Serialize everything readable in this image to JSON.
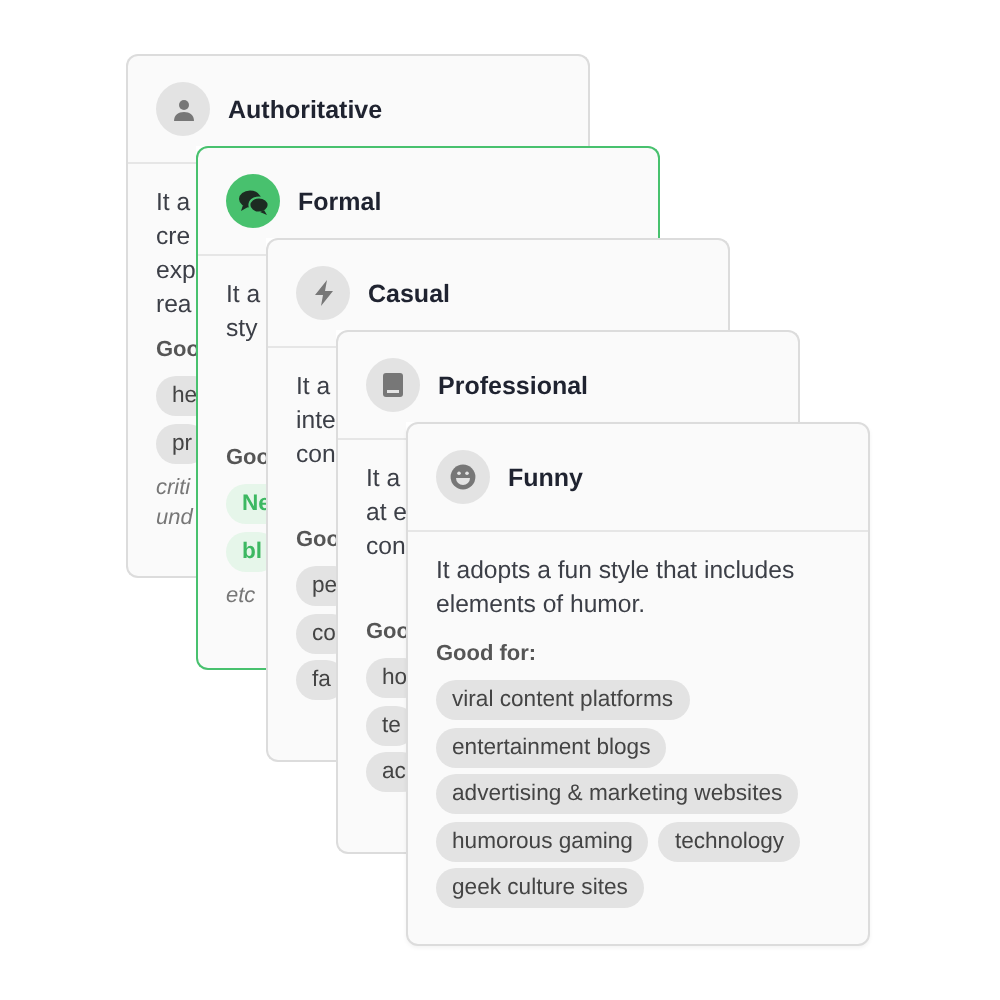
{
  "cards": [
    {
      "title": "Authoritative",
      "selected": false,
      "description_lines": [
        "It a",
        "cre",
        "exp",
        "rea"
      ],
      "good_for_label": "Goo",
      "tag_rows": [
        [
          "he"
        ],
        [
          "pr"
        ]
      ],
      "note_lines": [
        "criti",
        "und"
      ]
    },
    {
      "title": "Formal",
      "selected": true,
      "description_lines": [
        "It a",
        "sty"
      ],
      "good_for_label": "Goo",
      "tag_rows": [
        [
          "Ne"
        ],
        [
          "bl"
        ]
      ],
      "note_lines": [
        "etc"
      ]
    },
    {
      "title": "Casual",
      "selected": false,
      "description_lines": [
        "It a",
        "inte",
        "con"
      ],
      "good_for_label": "Goo",
      "tag_rows": [
        [
          "pe"
        ],
        [
          "co"
        ],
        [
          "fa"
        ]
      ]
    },
    {
      "title": "Professional",
      "selected": false,
      "description_lines": [
        "It a",
        "at e",
        "con"
      ],
      "good_for_label": "Goo",
      "tag_rows": [
        [
          "ho"
        ],
        [
          "te"
        ],
        [
          "ac"
        ]
      ]
    },
    {
      "title": "Funny",
      "selected": false,
      "description_lines": [
        "It adopts a fun style that includes elements of humor."
      ],
      "good_for_label": "Good for:",
      "tag_rows": [
        [
          "viral content platforms"
        ],
        [
          "entertainment blogs"
        ],
        [
          "advertising & marketing websites"
        ],
        [
          "humorous gaming",
          "technology"
        ],
        [
          "geek culture sites"
        ]
      ]
    }
  ]
}
